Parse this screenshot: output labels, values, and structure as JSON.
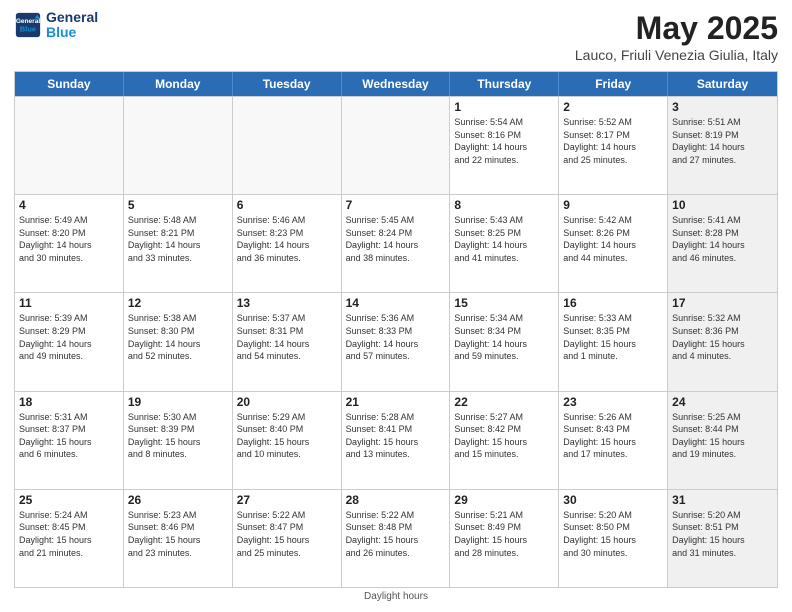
{
  "header": {
    "logo_line1": "General",
    "logo_line2": "Blue",
    "month_title": "May 2025",
    "subtitle": "Lauco, Friuli Venezia Giulia, Italy"
  },
  "days_of_week": [
    "Sunday",
    "Monday",
    "Tuesday",
    "Wednesday",
    "Thursday",
    "Friday",
    "Saturday"
  ],
  "footer": "Daylight hours",
  "weeks": [
    [
      {
        "day": "",
        "info": "",
        "empty": true
      },
      {
        "day": "",
        "info": "",
        "empty": true
      },
      {
        "day": "",
        "info": "",
        "empty": true
      },
      {
        "day": "",
        "info": "",
        "empty": true
      },
      {
        "day": "1",
        "info": "Sunrise: 5:54 AM\nSunset: 8:16 PM\nDaylight: 14 hours\nand 22 minutes.",
        "empty": false
      },
      {
        "day": "2",
        "info": "Sunrise: 5:52 AM\nSunset: 8:17 PM\nDaylight: 14 hours\nand 25 minutes.",
        "empty": false
      },
      {
        "day": "3",
        "info": "Sunrise: 5:51 AM\nSunset: 8:19 PM\nDaylight: 14 hours\nand 27 minutes.",
        "empty": false,
        "shaded": true
      }
    ],
    [
      {
        "day": "4",
        "info": "Sunrise: 5:49 AM\nSunset: 8:20 PM\nDaylight: 14 hours\nand 30 minutes.",
        "empty": false
      },
      {
        "day": "5",
        "info": "Sunrise: 5:48 AM\nSunset: 8:21 PM\nDaylight: 14 hours\nand 33 minutes.",
        "empty": false
      },
      {
        "day": "6",
        "info": "Sunrise: 5:46 AM\nSunset: 8:23 PM\nDaylight: 14 hours\nand 36 minutes.",
        "empty": false
      },
      {
        "day": "7",
        "info": "Sunrise: 5:45 AM\nSunset: 8:24 PM\nDaylight: 14 hours\nand 38 minutes.",
        "empty": false
      },
      {
        "day": "8",
        "info": "Sunrise: 5:43 AM\nSunset: 8:25 PM\nDaylight: 14 hours\nand 41 minutes.",
        "empty": false
      },
      {
        "day": "9",
        "info": "Sunrise: 5:42 AM\nSunset: 8:26 PM\nDaylight: 14 hours\nand 44 minutes.",
        "empty": false
      },
      {
        "day": "10",
        "info": "Sunrise: 5:41 AM\nSunset: 8:28 PM\nDaylight: 14 hours\nand 46 minutes.",
        "empty": false,
        "shaded": true
      }
    ],
    [
      {
        "day": "11",
        "info": "Sunrise: 5:39 AM\nSunset: 8:29 PM\nDaylight: 14 hours\nand 49 minutes.",
        "empty": false
      },
      {
        "day": "12",
        "info": "Sunrise: 5:38 AM\nSunset: 8:30 PM\nDaylight: 14 hours\nand 52 minutes.",
        "empty": false
      },
      {
        "day": "13",
        "info": "Sunrise: 5:37 AM\nSunset: 8:31 PM\nDaylight: 14 hours\nand 54 minutes.",
        "empty": false
      },
      {
        "day": "14",
        "info": "Sunrise: 5:36 AM\nSunset: 8:33 PM\nDaylight: 14 hours\nand 57 minutes.",
        "empty": false
      },
      {
        "day": "15",
        "info": "Sunrise: 5:34 AM\nSunset: 8:34 PM\nDaylight: 14 hours\nand 59 minutes.",
        "empty": false
      },
      {
        "day": "16",
        "info": "Sunrise: 5:33 AM\nSunset: 8:35 PM\nDaylight: 15 hours\nand 1 minute.",
        "empty": false
      },
      {
        "day": "17",
        "info": "Sunrise: 5:32 AM\nSunset: 8:36 PM\nDaylight: 15 hours\nand 4 minutes.",
        "empty": false,
        "shaded": true
      }
    ],
    [
      {
        "day": "18",
        "info": "Sunrise: 5:31 AM\nSunset: 8:37 PM\nDaylight: 15 hours\nand 6 minutes.",
        "empty": false
      },
      {
        "day": "19",
        "info": "Sunrise: 5:30 AM\nSunset: 8:39 PM\nDaylight: 15 hours\nand 8 minutes.",
        "empty": false
      },
      {
        "day": "20",
        "info": "Sunrise: 5:29 AM\nSunset: 8:40 PM\nDaylight: 15 hours\nand 10 minutes.",
        "empty": false
      },
      {
        "day": "21",
        "info": "Sunrise: 5:28 AM\nSunset: 8:41 PM\nDaylight: 15 hours\nand 13 minutes.",
        "empty": false
      },
      {
        "day": "22",
        "info": "Sunrise: 5:27 AM\nSunset: 8:42 PM\nDaylight: 15 hours\nand 15 minutes.",
        "empty": false
      },
      {
        "day": "23",
        "info": "Sunrise: 5:26 AM\nSunset: 8:43 PM\nDaylight: 15 hours\nand 17 minutes.",
        "empty": false
      },
      {
        "day": "24",
        "info": "Sunrise: 5:25 AM\nSunset: 8:44 PM\nDaylight: 15 hours\nand 19 minutes.",
        "empty": false,
        "shaded": true
      }
    ],
    [
      {
        "day": "25",
        "info": "Sunrise: 5:24 AM\nSunset: 8:45 PM\nDaylight: 15 hours\nand 21 minutes.",
        "empty": false
      },
      {
        "day": "26",
        "info": "Sunrise: 5:23 AM\nSunset: 8:46 PM\nDaylight: 15 hours\nand 23 minutes.",
        "empty": false
      },
      {
        "day": "27",
        "info": "Sunrise: 5:22 AM\nSunset: 8:47 PM\nDaylight: 15 hours\nand 25 minutes.",
        "empty": false
      },
      {
        "day": "28",
        "info": "Sunrise: 5:22 AM\nSunset: 8:48 PM\nDaylight: 15 hours\nand 26 minutes.",
        "empty": false
      },
      {
        "day": "29",
        "info": "Sunrise: 5:21 AM\nSunset: 8:49 PM\nDaylight: 15 hours\nand 28 minutes.",
        "empty": false
      },
      {
        "day": "30",
        "info": "Sunrise: 5:20 AM\nSunset: 8:50 PM\nDaylight: 15 hours\nand 30 minutes.",
        "empty": false
      },
      {
        "day": "31",
        "info": "Sunrise: 5:20 AM\nSunset: 8:51 PM\nDaylight: 15 hours\nand 31 minutes.",
        "empty": false,
        "shaded": true
      }
    ]
  ]
}
